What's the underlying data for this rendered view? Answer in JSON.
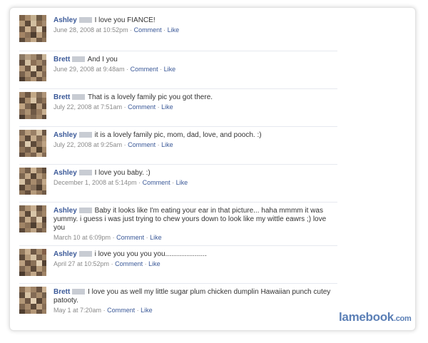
{
  "comments": [
    {
      "name": "Ashley",
      "text": "I love you FIANCE!",
      "date": "June 28, 2008 at 10:52pm",
      "comment_label": "Comment",
      "like_label": "Like"
    },
    {
      "name": "Brett",
      "text": "And I you",
      "date": "June 29, 2008 at 9:48am",
      "comment_label": "Comment",
      "like_label": "Like"
    },
    {
      "name": "Brett",
      "text": "That is a lovely family pic you got there.",
      "date": "July 22, 2008 at 7:51am",
      "comment_label": "Comment",
      "like_label": "Like"
    },
    {
      "name": "Ashley",
      "text": "it is a lovely family pic, mom, dad, love, and pooch. :)",
      "date": "July 22, 2008 at 9:25am",
      "comment_label": "Comment",
      "like_label": "Like"
    },
    {
      "name": "Ashley",
      "text": "I love you baby. :)",
      "date": "December 1, 2008 at 5:14pm",
      "comment_label": "Comment",
      "like_label": "Like"
    },
    {
      "name": "Ashley",
      "text": "Baby it looks like I'm eating your ear in that picture... haha mmmm it was yummy. i guess i was just trying to chew yours down to look like my wittle eawrs ;) love you",
      "date": "March 10 at 6:09pm",
      "comment_label": "Comment",
      "like_label": "Like"
    },
    {
      "name": "Ashley",
      "text": "i love you you you you.....................",
      "date": "April 27 at 10:52pm",
      "comment_label": "Comment",
      "like_label": "Like"
    },
    {
      "name": "Brett",
      "text": "I love you as well my little sugar plum chicken dumplin Hawaiian punch cutey patooty.",
      "date": "May 1 at 7:20am",
      "comment_label": "Comment",
      "like_label": "Like"
    }
  ],
  "separator": "·",
  "logo": {
    "main": "lamebook",
    "tld": ".com"
  },
  "colors": {
    "name_link": "#3b5998",
    "meta": "#8a8a8a",
    "text": "#333333",
    "logo": "#5b7fb6"
  }
}
